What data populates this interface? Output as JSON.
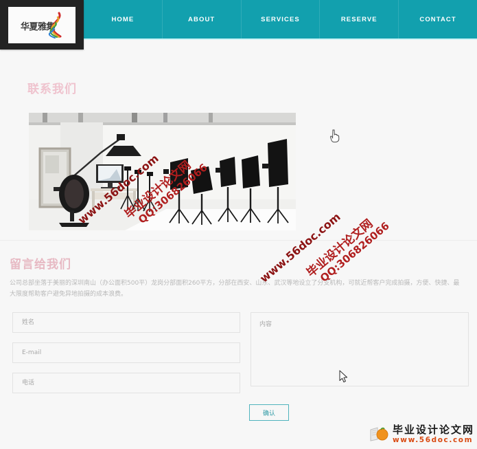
{
  "site": {
    "logo_text": "华夏雅集",
    "logo_icon": "colored-ribbon-swirl"
  },
  "nav": {
    "items": [
      {
        "label": "HOME"
      },
      {
        "label": "ABOUT"
      },
      {
        "label": "SERVICES"
      },
      {
        "label": "RESERVE"
      },
      {
        "label": "CONTACT"
      }
    ],
    "background_color": "#12a0ae",
    "text_color": "#ffffff"
  },
  "contact_section": {
    "heading": "联系我们",
    "heading_color": "#efc3ce",
    "photo_alt": "photography-studio-with-light-stands-softboxes-desk-monitor-and-office-chair"
  },
  "message_section": {
    "heading": "留言给我们",
    "heading_color": "#e7b9c3",
    "paragraph": "公司总部坐落于美丽的深圳南山（办公面积500平）龙岗分部面积260平方，分部在西安、山东、武汉等地设立了分支机构，可就近帮客户完成拍摄，方便、快捷、最大限度帮助客户避免异地拍摄的成本浪费。"
  },
  "form": {
    "name_placeholder": "姓名",
    "email_placeholder": "E-mail",
    "phone_placeholder": "电话",
    "content_placeholder": "内容",
    "name_value": "",
    "email_value": "",
    "phone_value": "",
    "content_value": "",
    "submit_label": "确认",
    "submit_color": "#2f9aa6",
    "submit_border_color": "#4fb3bd"
  },
  "watermarks": {
    "cn": "毕业设计论文网",
    "url": "www.56doc.com",
    "qq": "QQ:306826066",
    "color": "#b01e1e"
  },
  "footer_badge": {
    "cn": "毕业设计论文网",
    "url": "www.56doc.com",
    "icon": "orange-book-logo-icon",
    "url_color": "#d94a12"
  },
  "cursors": {
    "hand_icon": "pointing-hand-cursor",
    "arrow_icon": "arrow-cursor"
  }
}
